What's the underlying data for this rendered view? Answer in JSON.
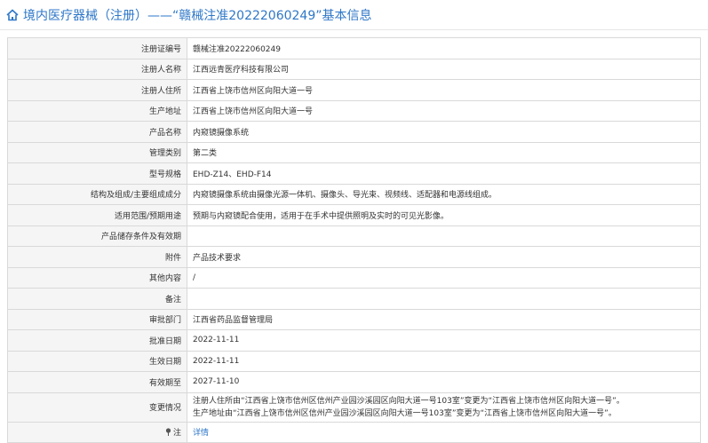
{
  "header": {
    "title": "境内医疗器械（注册）——“赣械注准20222060249”基本信息",
    "icon": "home-icon",
    "accent": "#2e77c8"
  },
  "rows": [
    {
      "label": "注册证编号",
      "value": "赣械注准20222060249"
    },
    {
      "label": "注册人名称",
      "value": "江西远青医疗科技有限公司"
    },
    {
      "label": "注册人住所",
      "value": "江西省上饶市信州区向阳大道一号"
    },
    {
      "label": "生产地址",
      "value": "江西省上饶市信州区向阳大道一号"
    },
    {
      "label": "产品名称",
      "value": "内窥镜摄像系统"
    },
    {
      "label": "管理类别",
      "value": "第二类"
    },
    {
      "label": "型号规格",
      "value": "EHD-Z14、EHD-F14"
    },
    {
      "label": "结构及组成/主要组成成分",
      "value": "内窥镜摄像系统由摄像光源一体机、摄像头、导光束、视频线、适配器和电源线组成。"
    },
    {
      "label": "适用范围/预期用途",
      "value": "预期与内窥镜配合使用，适用于在手术中提供照明及实时的可见光影像。"
    },
    {
      "label": "产品储存条件及有效期",
      "value": ""
    },
    {
      "label": "附件",
      "value": "产品技术要求"
    },
    {
      "label": "其他内容",
      "value": "/"
    },
    {
      "label": "备注",
      "value": ""
    },
    {
      "label": "审批部门",
      "value": "江西省药品监督管理局"
    },
    {
      "label": "批准日期",
      "value": "2022-11-11"
    },
    {
      "label": "生效日期",
      "value": "2022-11-11"
    },
    {
      "label": "有效期至",
      "value": "2027-11-10"
    }
  ],
  "change": {
    "label": "变更情况",
    "lines": [
      "注册人住所由“江西省上饶市信州区信州产业园沙溪园区向阳大道一号103室”变更为“江西省上饶市信州区向阳大道一号”。",
      "生产地址由“江西省上饶市信州区信州产业园沙溪园区向阳大道一号103室”变更为“江西省上饶市信州区向阳大道一号”。"
    ]
  },
  "note": {
    "label": "注",
    "icon": "pin-icon",
    "link": "详情"
  }
}
